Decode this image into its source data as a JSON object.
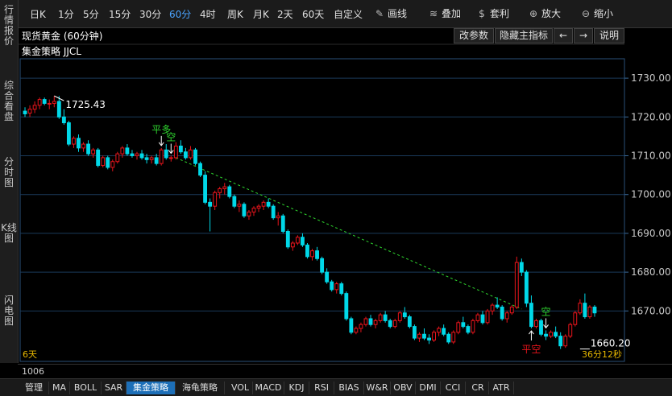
{
  "sidebar": {
    "items": [
      {
        "label": "行情报价",
        "active": false
      },
      {
        "label": "综合看盘",
        "active": false
      },
      {
        "label": "分时图",
        "active": false
      },
      {
        "label": "K线图",
        "active": true
      },
      {
        "label": "闪电图",
        "active": false
      }
    ]
  },
  "toolbar": {
    "periods": [
      "日K",
      "1分",
      "5分",
      "15分",
      "30分",
      "60分",
      "4时",
      "周K",
      "月K",
      "2天",
      "60天",
      "自定义"
    ],
    "active_period": "60分",
    "tools": [
      {
        "label": "画线",
        "icon": "pencil-icon"
      },
      {
        "label": "叠加",
        "icon": "stack-icon"
      },
      {
        "label": "套利",
        "icon": "moneybag-icon"
      },
      {
        "label": "放大",
        "icon": "zoom-in-icon"
      },
      {
        "label": "缩小",
        "icon": "zoom-out-icon"
      }
    ]
  },
  "info": {
    "title": "现货黄金 (60分钟)",
    "strategy": "集金策略  JJCL",
    "buttons": [
      "改参数",
      "隐藏主指标",
      "←",
      "→",
      "说明"
    ]
  },
  "status": {
    "days_label": "6天",
    "countdown": "36分12秒",
    "bar_count": "1006"
  },
  "bottom_tabs": {
    "active": "集金策略",
    "items": [
      "管理",
      "MA",
      "BOLL",
      "SAR",
      "集金策略",
      "海龟策略",
      "VOL",
      "MACD",
      "KDJ",
      "RSI",
      "BIAS",
      "W&R",
      "OBV",
      "DMI",
      "CCI",
      "CR",
      "ATR"
    ]
  },
  "colors": {
    "up": "#e8141b",
    "down": "#00d8e8",
    "grid": "#1a3a5a",
    "trendline": "#2fd62f",
    "accent": "#4aa3ff",
    "signal_green": "#2fd62f",
    "signal_red": "#e8141b"
  },
  "chart_data": {
    "type": "candlestick",
    "ylim": [
      1657,
      1735
    ],
    "yticks": [
      1730,
      1720,
      1710,
      1700,
      1690,
      1680,
      1670
    ],
    "ytick_labels": [
      "1730.00",
      "1720.00",
      "1710.00",
      "1700.00",
      "1690.00",
      "1680.00",
      "1670.00"
    ],
    "annotations": [
      {
        "text": "1725.43",
        "bar_index": 7,
        "price": 1725.43
      },
      {
        "text": "1660.20",
        "bar_index": 114,
        "price": 1660.2
      }
    ],
    "signals": [
      {
        "text": "平多",
        "bar_index": 28,
        "color": "green",
        "arrow": "down"
      },
      {
        "text": "空",
        "bar_index": 30,
        "color": "green",
        "arrow": "down"
      },
      {
        "text": "平空",
        "bar_index": 104,
        "color": "red",
        "arrow": "up"
      },
      {
        "text": "空",
        "bar_index": 107,
        "color": "green",
        "arrow": "down"
      }
    ],
    "trendline": {
      "from": {
        "bar_index": 31,
        "price": 1709.5
      },
      "to": {
        "bar_index": 102,
        "price": 1670.5
      }
    },
    "candles": [
      [
        1721.5,
        1722.5,
        1720,
        1720.8
      ],
      [
        1721,
        1723,
        1720,
        1722
      ],
      [
        1722,
        1724,
        1721,
        1723
      ],
      [
        1723,
        1725,
        1722,
        1724.5
      ],
      [
        1724.5,
        1725,
        1723,
        1723.5
      ],
      [
        1723.5,
        1724.5,
        1722,
        1723.5
      ],
      [
        1723.5,
        1725.43,
        1722.5,
        1724
      ],
      [
        1724,
        1725.4,
        1719.5,
        1720
      ],
      [
        1720,
        1722,
        1718,
        1718.5
      ],
      [
        1718.5,
        1719,
        1712.5,
        1713
      ],
      [
        1713,
        1715,
        1712,
        1714.5
      ],
      [
        1714.5,
        1715.5,
        1711,
        1712
      ],
      [
        1712,
        1713.5,
        1711,
        1713
      ],
      [
        1713,
        1714,
        1710,
        1710.5
      ],
      [
        1710.5,
        1712,
        1709.5,
        1711.5
      ],
      [
        1711.5,
        1712,
        1707,
        1707.5
      ],
      [
        1707.5,
        1710,
        1707,
        1709.5
      ],
      [
        1709.5,
        1710,
        1706.5,
        1707
      ],
      [
        1707,
        1709,
        1706,
        1708.5
      ],
      [
        1708.5,
        1711,
        1708,
        1710.5
      ],
      [
        1710.5,
        1712.5,
        1709.5,
        1712
      ],
      [
        1712,
        1713,
        1710,
        1710.5
      ],
      [
        1710.5,
        1711.5,
        1709.5,
        1710
      ],
      [
        1710,
        1711,
        1709,
        1710.5
      ],
      [
        1710.5,
        1711.5,
        1709,
        1709.5
      ],
      [
        1709.5,
        1710.5,
        1708,
        1709
      ],
      [
        1709,
        1710,
        1708,
        1709.5
      ],
      [
        1709.5,
        1710.5,
        1707.5,
        1708
      ],
      [
        1708,
        1712,
        1707.5,
        1711.5
      ],
      [
        1711.5,
        1713,
        1709,
        1709.5
      ],
      [
        1709.5,
        1710,
        1708.5,
        1709.5
      ],
      [
        1709.5,
        1713.5,
        1709,
        1712.5
      ],
      [
        1712.5,
        1714,
        1710.5,
        1711
      ],
      [
        1711,
        1712,
        1709,
        1709.5
      ],
      [
        1709.5,
        1712.5,
        1709,
        1711.5
      ],
      [
        1711.5,
        1712,
        1707.5,
        1708
      ],
      [
        1708,
        1708.5,
        1704.5,
        1705
      ],
      [
        1705,
        1706,
        1697.5,
        1698
      ],
      [
        1698,
        1699,
        1690.5,
        1697
      ],
      [
        1697,
        1701,
        1696,
        1700.5
      ],
      [
        1700.5,
        1702,
        1699,
        1701.5
      ],
      [
        1701.5,
        1703,
        1700,
        1702
      ],
      [
        1702,
        1702.5,
        1699,
        1699.5
      ],
      [
        1699.5,
        1700,
        1696.5,
        1697
      ],
      [
        1697,
        1698.5,
        1695.5,
        1697.5
      ],
      [
        1697.5,
        1698,
        1694,
        1694.5
      ],
      [
        1694.5,
        1696,
        1693.5,
        1695.5
      ],
      [
        1695.5,
        1697,
        1694.5,
        1696.5
      ],
      [
        1696.5,
        1697.5,
        1695.5,
        1697
      ],
      [
        1697,
        1698.5,
        1696,
        1698
      ],
      [
        1698,
        1699,
        1696.5,
        1697
      ],
      [
        1697,
        1697.5,
        1693.5,
        1694
      ],
      [
        1694,
        1695.5,
        1692,
        1694.5
      ],
      [
        1694.5,
        1695,
        1690,
        1690.5
      ],
      [
        1690.5,
        1691,
        1686,
        1686.5
      ],
      [
        1686.5,
        1688,
        1685.5,
        1687.5
      ],
      [
        1687.5,
        1689.5,
        1687,
        1689
      ],
      [
        1689,
        1690,
        1686.5,
        1687
      ],
      [
        1687,
        1687.5,
        1683.5,
        1684
      ],
      [
        1684,
        1686,
        1683,
        1685.5
      ],
      [
        1685.5,
        1686.5,
        1683,
        1683.5
      ],
      [
        1683.5,
        1684,
        1679.5,
        1680
      ],
      [
        1680,
        1681,
        1677,
        1677.5
      ],
      [
        1677.5,
        1678,
        1675,
        1675.5
      ],
      [
        1675.5,
        1677.5,
        1674.5,
        1677
      ],
      [
        1677,
        1677.5,
        1674,
        1674.5
      ],
      [
        1674.5,
        1675,
        1667.5,
        1668
      ],
      [
        1668,
        1668.5,
        1664,
        1664.5
      ],
      [
        1664.5,
        1666,
        1664,
        1665.5
      ],
      [
        1665.5,
        1667,
        1664.5,
        1666.5
      ],
      [
        1666.5,
        1668.5,
        1666,
        1668
      ],
      [
        1668,
        1669,
        1666,
        1666.5
      ],
      [
        1666.5,
        1668,
        1665.5,
        1667.5
      ],
      [
        1667.5,
        1669.5,
        1667,
        1669
      ],
      [
        1669,
        1670,
        1667,
        1667.5
      ],
      [
        1667.5,
        1668,
        1665.5,
        1666
      ],
      [
        1666,
        1668,
        1665.5,
        1667.5
      ],
      [
        1667.5,
        1670,
        1667,
        1669.5
      ],
      [
        1669.5,
        1671,
        1668,
        1668.5
      ],
      [
        1668.5,
        1669,
        1665.5,
        1666
      ],
      [
        1666,
        1666.5,
        1662.5,
        1663
      ],
      [
        1663,
        1664.5,
        1662,
        1664
      ],
      [
        1664,
        1665.5,
        1662.5,
        1663
      ],
      [
        1663,
        1664,
        1661.5,
        1662.5
      ],
      [
        1662.5,
        1665,
        1662,
        1664.5
      ],
      [
        1664.5,
        1666,
        1663.5,
        1665.5
      ],
      [
        1665.5,
        1666.5,
        1663.5,
        1664
      ],
      [
        1664,
        1664.5,
        1661.5,
        1662
      ],
      [
        1662,
        1665,
        1661.5,
        1664.5
      ],
      [
        1664.5,
        1667.5,
        1664,
        1667
      ],
      [
        1667,
        1668.5,
        1665.5,
        1666
      ],
      [
        1666,
        1666.5,
        1664,
        1664.5
      ],
      [
        1664.5,
        1668,
        1664,
        1667.5
      ],
      [
        1667.5,
        1669.5,
        1667,
        1669
      ],
      [
        1669,
        1670,
        1666.5,
        1667
      ],
      [
        1667,
        1670.5,
        1666.5,
        1670
      ],
      [
        1670,
        1672,
        1669,
        1671.5
      ],
      [
        1671.5,
        1673.5,
        1670.5,
        1671
      ],
      [
        1671,
        1671.5,
        1667.5,
        1668
      ],
      [
        1668,
        1670,
        1667,
        1669.5
      ],
      [
        1669.5,
        1671.5,
        1669,
        1671
      ],
      [
        1671,
        1684,
        1670.5,
        1682.5
      ],
      [
        1682.5,
        1683.5,
        1679,
        1680
      ],
      [
        1680,
        1680.5,
        1671,
        1672
      ],
      [
        1672,
        1674,
        1665.5,
        1666
      ],
      [
        1666,
        1668,
        1665.5,
        1667.5
      ],
      [
        1667.5,
        1668,
        1663.5,
        1664
      ],
      [
        1664,
        1665,
        1662.5,
        1663.5
      ],
      [
        1663.5,
        1665,
        1663,
        1664.5
      ],
      [
        1664.5,
        1666,
        1663,
        1663.5
      ],
      [
        1663.5,
        1664.5,
        1660.2,
        1661
      ],
      [
        1661,
        1664,
        1660.5,
        1663.5
      ],
      [
        1663.5,
        1667,
        1663,
        1666.5
      ],
      [
        1666.5,
        1670,
        1666,
        1669.5
      ],
      [
        1669.5,
        1673,
        1669,
        1672
      ],
      [
        1672,
        1674.5,
        1668,
        1668.5
      ],
      [
        1668.5,
        1671.5,
        1668,
        1671
      ],
      [
        1671,
        1671.5,
        1668.5,
        1669.5
      ]
    ]
  }
}
